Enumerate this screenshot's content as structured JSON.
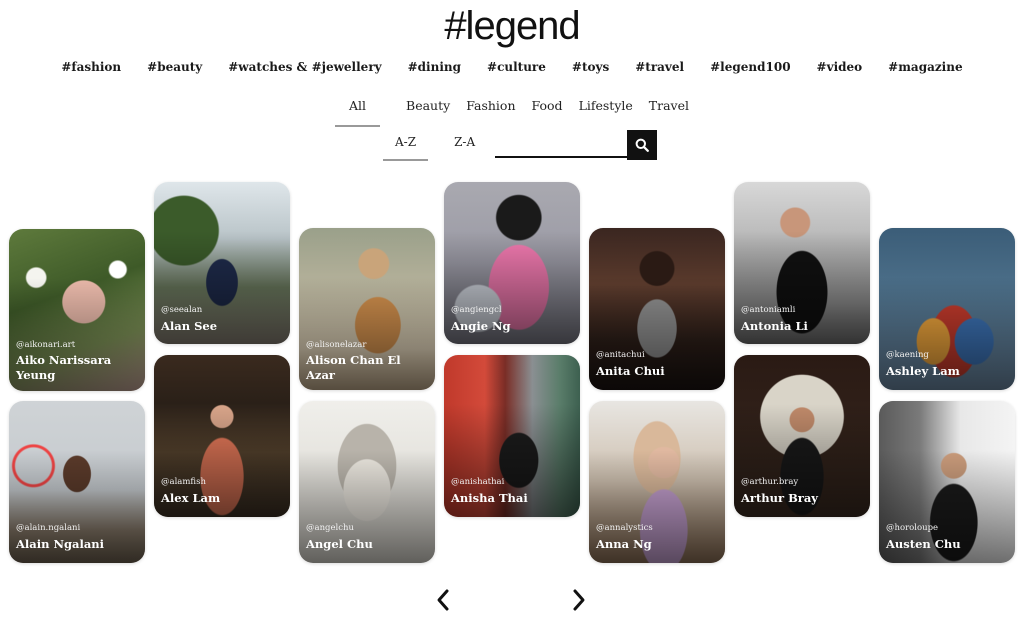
{
  "brand": {
    "logo": "#legend"
  },
  "main_nav": [
    "#fashion",
    "#beauty",
    "#watches & #jewellery",
    "#dining",
    "#culture",
    "#toys",
    "#travel",
    "#legend100",
    "#video",
    "#magazine"
  ],
  "category_tabs": {
    "items": [
      "All",
      "Beauty",
      "Fashion",
      "Food",
      "Lifestyle",
      "Travel"
    ],
    "active": "All"
  },
  "sort": {
    "az": "A-Z",
    "za": "Z-A",
    "active": "A-Z"
  },
  "search": {
    "value": "",
    "placeholder": ""
  },
  "icons": {
    "search": "search-icon",
    "prev": "chevron-left-icon",
    "next": "chevron-right-icon"
  },
  "influencers": [
    {
      "handle": "@aikonari.art",
      "name": "Aiko Narissara Yeung"
    },
    {
      "handle": "@alain.ngalani",
      "name": "Alain Ngalani"
    },
    {
      "handle": "@seealan",
      "name": "Alan See"
    },
    {
      "handle": "@alamfish",
      "name": "Alex Lam"
    },
    {
      "handle": "@alisonelazar",
      "name": "Alison Chan El Azar"
    },
    {
      "handle": "@angelchu",
      "name": "Angel Chu"
    },
    {
      "handle": "@angiengcl",
      "name": "Angie Ng"
    },
    {
      "handle": "@anishathai",
      "name": "Anisha Thai"
    },
    {
      "handle": "@anitachui",
      "name": "Anita Chui"
    },
    {
      "handle": "@annalystics",
      "name": "Anna Ng"
    },
    {
      "handle": "@antoniamli",
      "name": "Antonia Li"
    },
    {
      "handle": "@arthur.bray",
      "name": "Arthur Bray"
    },
    {
      "handle": "@kaening",
      "name": "Ashley Lam"
    },
    {
      "handle": "@horoloupe",
      "name": "Austen Chu"
    }
  ],
  "colors": {
    "text": "#1a1a1a",
    "accent": "#111111",
    "tab_underline": "#999999"
  }
}
